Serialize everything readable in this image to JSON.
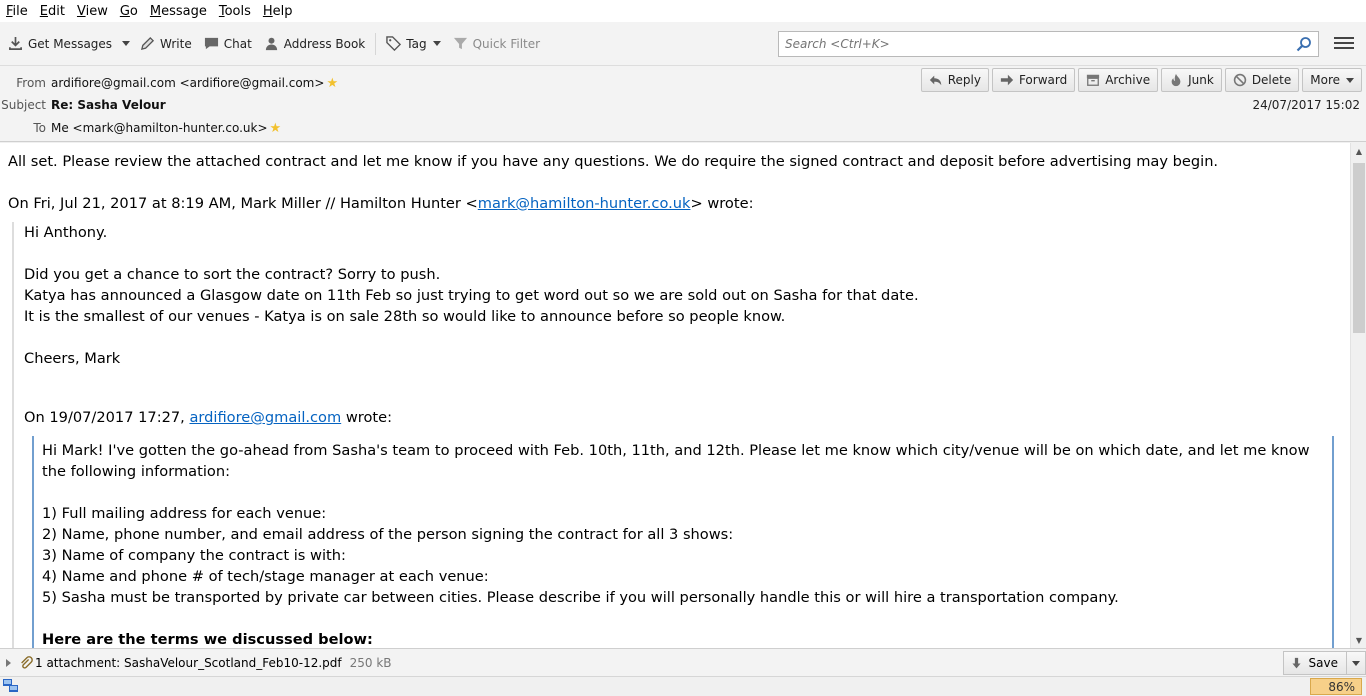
{
  "menu": {
    "items": [
      {
        "key": "F",
        "rest": "ile"
      },
      {
        "key": "E",
        "rest": "dit"
      },
      {
        "key": "V",
        "rest": "iew"
      },
      {
        "key": "G",
        "rest": "o"
      },
      {
        "key": "M",
        "rest": "essage"
      },
      {
        "key": "T",
        "rest": "ools"
      },
      {
        "key": "H",
        "rest": "elp"
      }
    ]
  },
  "toolbar": {
    "get_messages": "Get Messages",
    "write": "Write",
    "chat": "Chat",
    "address_book": "Address Book",
    "tag": "Tag",
    "quick_filter": "Quick Filter",
    "search_placeholder": "Search <Ctrl+K>"
  },
  "header": {
    "from_label": "From",
    "from_value": "ardifiore@gmail.com <ardifiore@gmail.com>",
    "subject_label": "Subject",
    "subject_value": "Re: Sasha Velour",
    "to_label": "To",
    "to_value": "Me <mark@hamilton-hunter.co.uk>",
    "date": "24/07/2017 15:02",
    "buttons": {
      "reply": "Reply",
      "forward": "Forward",
      "archive": "Archive",
      "junk": "Junk",
      "delete": "Delete",
      "more": "More"
    }
  },
  "message": {
    "line1": "All set. Please review the attached contract and let me know if you have any questions. We do require the signed contract and deposit before advertising may begin.",
    "attribution1_pre": "On Fri, Jul 21, 2017 at 8:19 AM, Mark Miller // Hamilton Hunter <",
    "attribution1_link": "mark@hamilton-hunter.co.uk",
    "attribution1_post": "> wrote:",
    "q1": {
      "greeting": "Hi Anthony.",
      "p1": "Did you get a chance to sort the contract? Sorry to push.",
      "p2": "Katya has announced a Glasgow date on 11th Feb so just trying to get word out so we are sold out on Sasha for that date.",
      "p3": "It is the smallest of our venues - Katya is on sale 28th so would like to announce before so people know.",
      "signoff": "Cheers, Mark",
      "attribution2_pre": "On 19/07/2017 17:27, ",
      "attribution2_link": "ardifiore@gmail.com",
      "attribution2_post": " wrote:"
    },
    "q2": {
      "intro": "Hi Mark! I've gotten the go-ahead from Sasha's team to proceed with Feb. 10th, 11th, and 12th. Please let me know which city/venue will be on which date, and let me know the following information:",
      "items": [
        "1) Full mailing address for each venue:",
        "2) Name, phone number, and email address of the person signing the contract for all 3 shows:",
        "3) Name of company the contract is with:",
        "4) Name and phone # of tech/stage manager at each venue:",
        "5) Sasha must be transported by private car between cities. Please describe if you will personally handle this or will hire a transportation company."
      ],
      "terms_heading": "Here are the terms we discussed below:"
    }
  },
  "attachment": {
    "label": "1 attachment: SashaVelour_Scotland_Feb10-12.pdf",
    "size": "250 kB",
    "save": "Save"
  },
  "status": {
    "zoom": "86%"
  }
}
